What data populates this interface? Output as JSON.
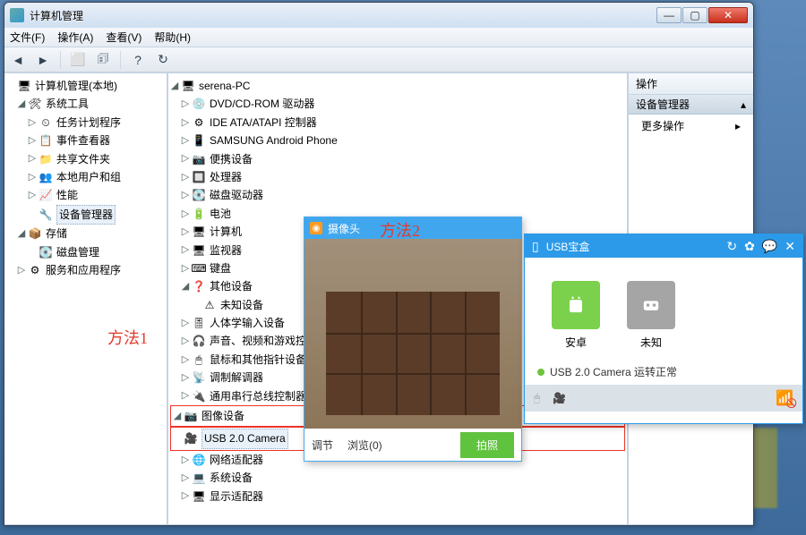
{
  "window": {
    "title": "计算机管理",
    "menus": {
      "file": "文件(F)",
      "action": "操作(A)",
      "view": "查看(V)",
      "help": "帮助(H)"
    },
    "winbtns": {
      "min": "—",
      "max": "▢",
      "close": "✕"
    }
  },
  "annotations": {
    "m1": "方法1",
    "m2": "方法2"
  },
  "leftTree": {
    "root": "计算机管理(本地)",
    "sysTools": "系统工具",
    "sysChildren": [
      "任务计划程序",
      "事件查看器",
      "共享文件夹",
      "本地用户和组",
      "性能",
      "设备管理器"
    ],
    "storage": "存储",
    "diskmgmt": "磁盘管理",
    "services": "服务和应用程序"
  },
  "midTree": {
    "root": "serena-PC",
    "items": [
      {
        "icon": "💿",
        "label": "DVD/CD-ROM 驱动器"
      },
      {
        "icon": "⚙",
        "label": "IDE ATA/ATAPI 控制器"
      },
      {
        "icon": "📱",
        "label": "SAMSUNG Android Phone"
      },
      {
        "icon": "📷",
        "label": "便携设备"
      },
      {
        "icon": "🔲",
        "label": "处理器"
      },
      {
        "icon": "💽",
        "label": "磁盘驱动器"
      },
      {
        "icon": "🔋",
        "label": "电池"
      },
      {
        "icon": "🖥",
        "label": "计算机"
      },
      {
        "icon": "🖥",
        "label": "监视器"
      },
      {
        "icon": "⌨",
        "label": "键盘"
      }
    ],
    "other": {
      "label": "其他设备",
      "child": "未知设备"
    },
    "items2": [
      {
        "icon": "🎚",
        "label": "人体学输入设备"
      },
      {
        "icon": "🎧",
        "label": "声音、视频和游戏控制器"
      },
      {
        "icon": "🖱",
        "label": "鼠标和其他指针设备"
      },
      {
        "icon": "📡",
        "label": "调制解调器"
      },
      {
        "icon": "🔌",
        "label": "通用串行总线控制器"
      }
    ],
    "imaging": {
      "label": "图像设备",
      "child": "USB 2.0 Camera"
    },
    "items3": [
      {
        "icon": "🌐",
        "label": "网络适配器"
      },
      {
        "icon": "💻",
        "label": "系统设备"
      },
      {
        "icon": "🖥",
        "label": "显示适配器"
      }
    ]
  },
  "rightPanel": {
    "header": "操作",
    "selected": "设备管理器",
    "more": "更多操作"
  },
  "camWin": {
    "title": "摄像头",
    "adjust": "调节",
    "browse": "浏览(0)",
    "snap": "拍照"
  },
  "usbWin": {
    "title": "USB宝盒",
    "devices": {
      "android": "安卓",
      "unknown": "未知"
    },
    "status": "USB 2.0 Camera 运转正常"
  }
}
